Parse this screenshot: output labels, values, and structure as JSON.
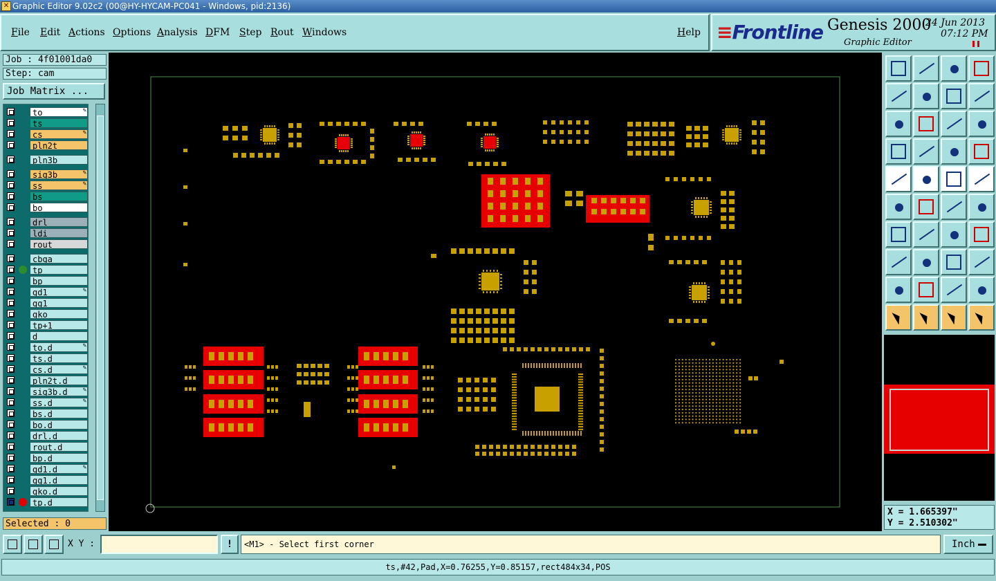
{
  "window": {
    "title": "Graphic Editor 9.02c2 (00@HY-HYCAM-PC041 - Windows, pid:2136)"
  },
  "menu": {
    "items": [
      "File",
      "Edit",
      "Actions",
      "Options",
      "Analysis",
      "DFM",
      "Step",
      "Rout",
      "Windows"
    ],
    "help": "Help"
  },
  "brand": {
    "logo": "Frontline",
    "product": "Genesis 2000",
    "subtitle": "Graphic Editor",
    "date": "24 Jun 2013",
    "time": "07:12 PM"
  },
  "job": {
    "job_label": "Job : 4f01001da0",
    "step_label": "Step: cam",
    "matrix_button": "Job Matrix ..."
  },
  "layers": [
    {
      "name": "to",
      "color": "#ffffff",
      "editable": true
    },
    {
      "name": "ts",
      "color": "#0f9b86",
      "editable": false
    },
    {
      "name": "cs",
      "color": "#f3c46a",
      "editable": true
    },
    {
      "name": "pln2t",
      "color": "#f3c46a",
      "editable": false
    },
    {
      "name": "pln3b",
      "color": "#b8e8e8",
      "editable": false
    },
    {
      "name": "sig3b",
      "color": "#f3c46a",
      "editable": true
    },
    {
      "name": "ss",
      "color": "#f3c46a",
      "editable": true
    },
    {
      "name": "bs",
      "color": "#0f9b86",
      "editable": false
    },
    {
      "name": "bo",
      "color": "#ffffff",
      "editable": false
    },
    {
      "name": "drl",
      "color": "#9bb0b8",
      "editable": false
    },
    {
      "name": "ldi",
      "color": "#9bb0b8",
      "editable": false
    },
    {
      "name": "rout",
      "color": "#d8d8d8",
      "editable": false
    },
    {
      "name": "cbga",
      "color": "#b8e8e8",
      "editable": false
    },
    {
      "name": "tp",
      "color": "#b8e8e8",
      "editable": false,
      "dot": "#2e8b2e"
    },
    {
      "name": "bp",
      "color": "#b8e8e8",
      "editable": false
    },
    {
      "name": "gd1",
      "color": "#b8e8e8",
      "editable": true
    },
    {
      "name": "gg1",
      "color": "#b8e8e8",
      "editable": false
    },
    {
      "name": "gko",
      "color": "#b8e8e8",
      "editable": false
    },
    {
      "name": "tp+1",
      "color": "#b8e8e8",
      "editable": false
    },
    {
      "name": "d",
      "color": "#b8e8e8",
      "editable": false
    },
    {
      "name": "to.d",
      "color": "#b8e8e8",
      "editable": true
    },
    {
      "name": "ts.d",
      "color": "#b8e8e8",
      "editable": false
    },
    {
      "name": "cs.d",
      "color": "#b8e8e8",
      "editable": true
    },
    {
      "name": "pln2t.d",
      "color": "#b8e8e8",
      "editable": false
    },
    {
      "name": "sig3b.d",
      "color": "#b8e8e8",
      "editable": true
    },
    {
      "name": "ss.d",
      "color": "#b8e8e8",
      "editable": true
    },
    {
      "name": "bs.d",
      "color": "#b8e8e8",
      "editable": false
    },
    {
      "name": "bo.d",
      "color": "#b8e8e8",
      "editable": false
    },
    {
      "name": "drl.d",
      "color": "#b8e8e8",
      "editable": false
    },
    {
      "name": "rout.d",
      "color": "#b8e8e8",
      "editable": false
    },
    {
      "name": "bp.d",
      "color": "#b8e8e8",
      "editable": false
    },
    {
      "name": "gd1.d",
      "color": "#b8e8e8",
      "editable": true
    },
    {
      "name": "gg1.d",
      "color": "#b8e8e8",
      "editable": false
    },
    {
      "name": "gko.d",
      "color": "#b8e8e8",
      "editable": false
    },
    {
      "name": "tp.d",
      "color": "#b8e8e8",
      "editable": false,
      "dot": "#e00000",
      "active": true
    }
  ],
  "selected": "Selected : 0",
  "coordinates": {
    "x": "X = 1.665397\"",
    "y": "Y = 2.510302\""
  },
  "bottom": {
    "xy_label": "X Y :",
    "xy_value": "",
    "excl": "!",
    "prompt": "<M1> - Select first corner",
    "unit": "Inch"
  },
  "status": "ts,#42,Pad,X=0.76255,Y=0.85157,rect484x34,POS",
  "colors": {
    "pad": "#c8a000",
    "selected": "#e60000",
    "outline": "#4c8c4c",
    "background": "#000000"
  }
}
